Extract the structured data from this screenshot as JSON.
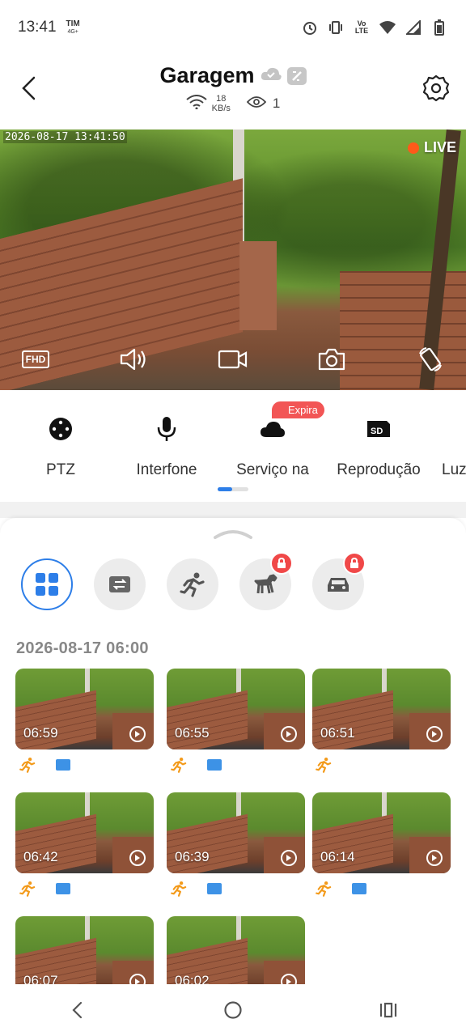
{
  "status_bar": {
    "time": "13:41",
    "carrier": "TIM",
    "carrier_sub": "4G+"
  },
  "header": {
    "title": "Garagem",
    "speed_value": "18",
    "speed_unit": "KB/s",
    "viewers": "1"
  },
  "video": {
    "timestamp": "2026-08-17 13:41:50",
    "live_label": "LIVE",
    "quality_label": "FHD"
  },
  "functions": [
    {
      "label": "PTZ",
      "icon": "ptz-icon"
    },
    {
      "label": "Interfone",
      "icon": "microphone-icon"
    },
    {
      "label": "Serviço na",
      "icon": "cloud-icon",
      "badge": "Expira"
    },
    {
      "label": "Reprodução",
      "icon": "sd-card-icon"
    },
    {
      "label": "Luz",
      "icon": "light-icon"
    }
  ],
  "filters": [
    {
      "name": "all-events",
      "active": true,
      "locked": false
    },
    {
      "name": "other-events",
      "active": false,
      "locked": false
    },
    {
      "name": "motion",
      "active": false,
      "locked": false
    },
    {
      "name": "pet",
      "active": false,
      "locked": true
    },
    {
      "name": "vehicle",
      "active": false,
      "locked": true
    }
  ],
  "events": {
    "date_header": "2026-08-17 06:00",
    "clips": [
      {
        "time": "06:59",
        "tags": [
          "motion",
          "other"
        ]
      },
      {
        "time": "06:55",
        "tags": [
          "motion",
          "other"
        ]
      },
      {
        "time": "06:51",
        "tags": [
          "motion"
        ]
      },
      {
        "time": "06:42",
        "tags": [
          "motion",
          "other"
        ]
      },
      {
        "time": "06:39",
        "tags": [
          "motion",
          "other"
        ]
      },
      {
        "time": "06:14",
        "tags": [
          "motion",
          "other"
        ]
      },
      {
        "time": "06:07",
        "tags": []
      },
      {
        "time": "06:02",
        "tags": []
      }
    ]
  },
  "colors": {
    "accent": "#2d7ee8",
    "motion_tag": "#f39a1a",
    "badge_red": "#f25555"
  }
}
